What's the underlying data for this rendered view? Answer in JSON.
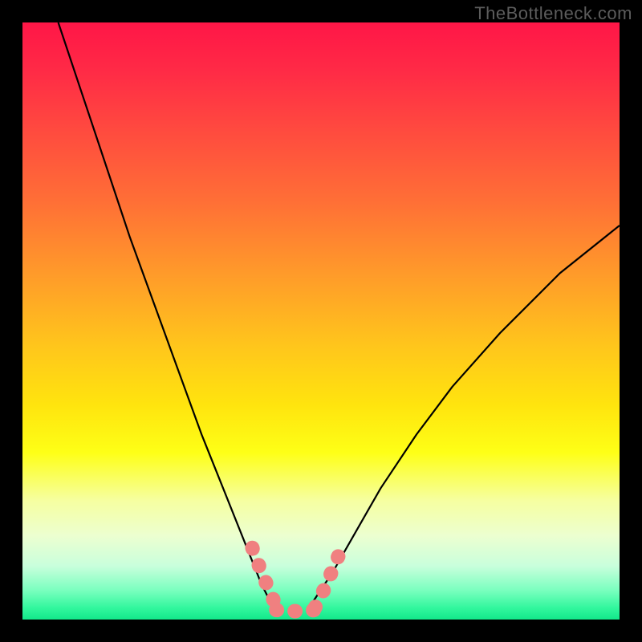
{
  "watermark": "TheBottleneck.com",
  "chart_data": {
    "type": "line",
    "title": "",
    "xlabel": "",
    "ylabel": "",
    "xlim": [
      0,
      100
    ],
    "ylim": [
      0,
      100
    ],
    "grid": false,
    "series": [
      {
        "name": "left-branch",
        "x": [
          6,
          10,
          14,
          18,
          22,
          26,
          30,
          34,
          38,
          40,
          42
        ],
        "y": [
          100,
          88,
          76,
          64,
          53,
          42,
          31,
          21,
          11,
          6,
          2
        ]
      },
      {
        "name": "right-branch",
        "x": [
          48,
          52,
          56,
          60,
          66,
          72,
          80,
          90,
          100
        ],
        "y": [
          2,
          8,
          15,
          22,
          31,
          39,
          48,
          58,
          66
        ]
      }
    ],
    "overlay_segments": [
      {
        "name": "left-pink-dots",
        "points": [
          [
            38.5,
            12
          ],
          [
            40,
            8
          ],
          [
            41.5,
            4.5
          ],
          [
            42.5,
            2.2
          ]
        ]
      },
      {
        "name": "bottom-pink-dots",
        "points": [
          [
            42.5,
            1.6
          ],
          [
            45,
            1.4
          ],
          [
            47,
            1.4
          ],
          [
            49,
            1.6
          ]
        ]
      },
      {
        "name": "right-pink-dots",
        "points": [
          [
            49,
            2
          ],
          [
            50.5,
            5
          ],
          [
            52,
            8.5
          ],
          [
            53.5,
            12
          ]
        ]
      }
    ],
    "background_gradient_stops": [
      {
        "pos": 0,
        "color": "#ff1647"
      },
      {
        "pos": 50,
        "color": "#ffd21a"
      },
      {
        "pos": 78,
        "color": "#feff60"
      },
      {
        "pos": 100,
        "color": "#12e88a"
      }
    ]
  }
}
